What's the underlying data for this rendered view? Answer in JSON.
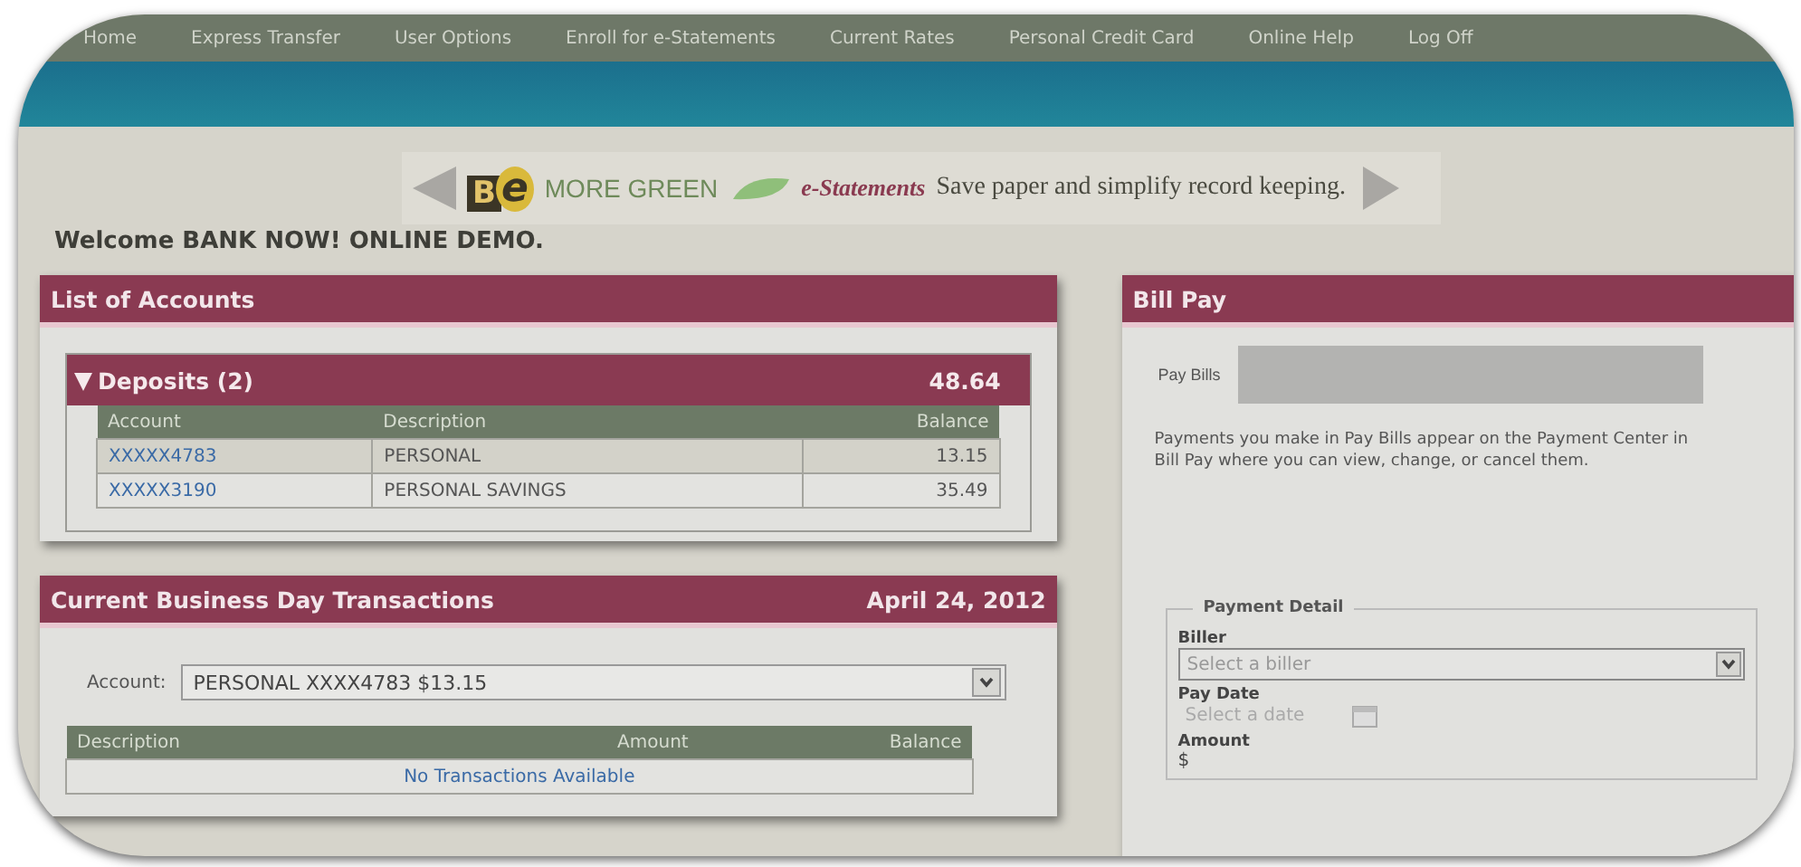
{
  "nav": [
    {
      "label": "Home"
    },
    {
      "label": "Express Transfer"
    },
    {
      "label": "User Options"
    },
    {
      "label": "Enroll for e-Statements"
    },
    {
      "label": "Current Rates"
    },
    {
      "label": "Personal Credit Card"
    },
    {
      "label": "Online Help"
    },
    {
      "label": "Log Off"
    }
  ],
  "banner": {
    "logo_letters": [
      "B",
      "e"
    ],
    "headline": "MORE GREEN",
    "product": "e-Statements",
    "tagline": "Save paper and simplify record keeping."
  },
  "welcome": "Welcome BANK NOW! ONLINE DEMO.",
  "accounts_panel": {
    "title": "List of Accounts",
    "group": {
      "title": "Deposits (2)",
      "expanded": true,
      "total": "48.64",
      "columns": [
        "Account",
        "Description",
        "Balance"
      ],
      "rows": [
        {
          "account": "XXXXX4783",
          "description": "PERSONAL",
          "balance": "13.15"
        },
        {
          "account": "XXXXX3190",
          "description": "PERSONAL SAVINGS",
          "balance": "35.49"
        }
      ]
    }
  },
  "transactions_panel": {
    "title": "Current Business Day Transactions",
    "date": "April 24, 2012",
    "account_label": "Account:",
    "account_value": "PERSONAL XXXX4783 $13.15",
    "columns": [
      "Description",
      "Amount",
      "Balance"
    ],
    "empty_message": "No Transactions Available"
  },
  "bill_pay": {
    "title": "Bill Pay",
    "tabs": [
      {
        "label": "Pay Bills",
        "selected": true
      }
    ],
    "info": "Payments you make in Pay Bills appear on the Payment Center in Bill Pay where you can view, change, or cancel them.",
    "detail": {
      "legend": "Payment Detail",
      "biller_label": "Biller",
      "biller_value": "Select a biller",
      "date_label": "Pay Date",
      "date_placeholder": "Select a date",
      "amount_label": "Amount",
      "amount_prefix": "$"
    }
  }
}
